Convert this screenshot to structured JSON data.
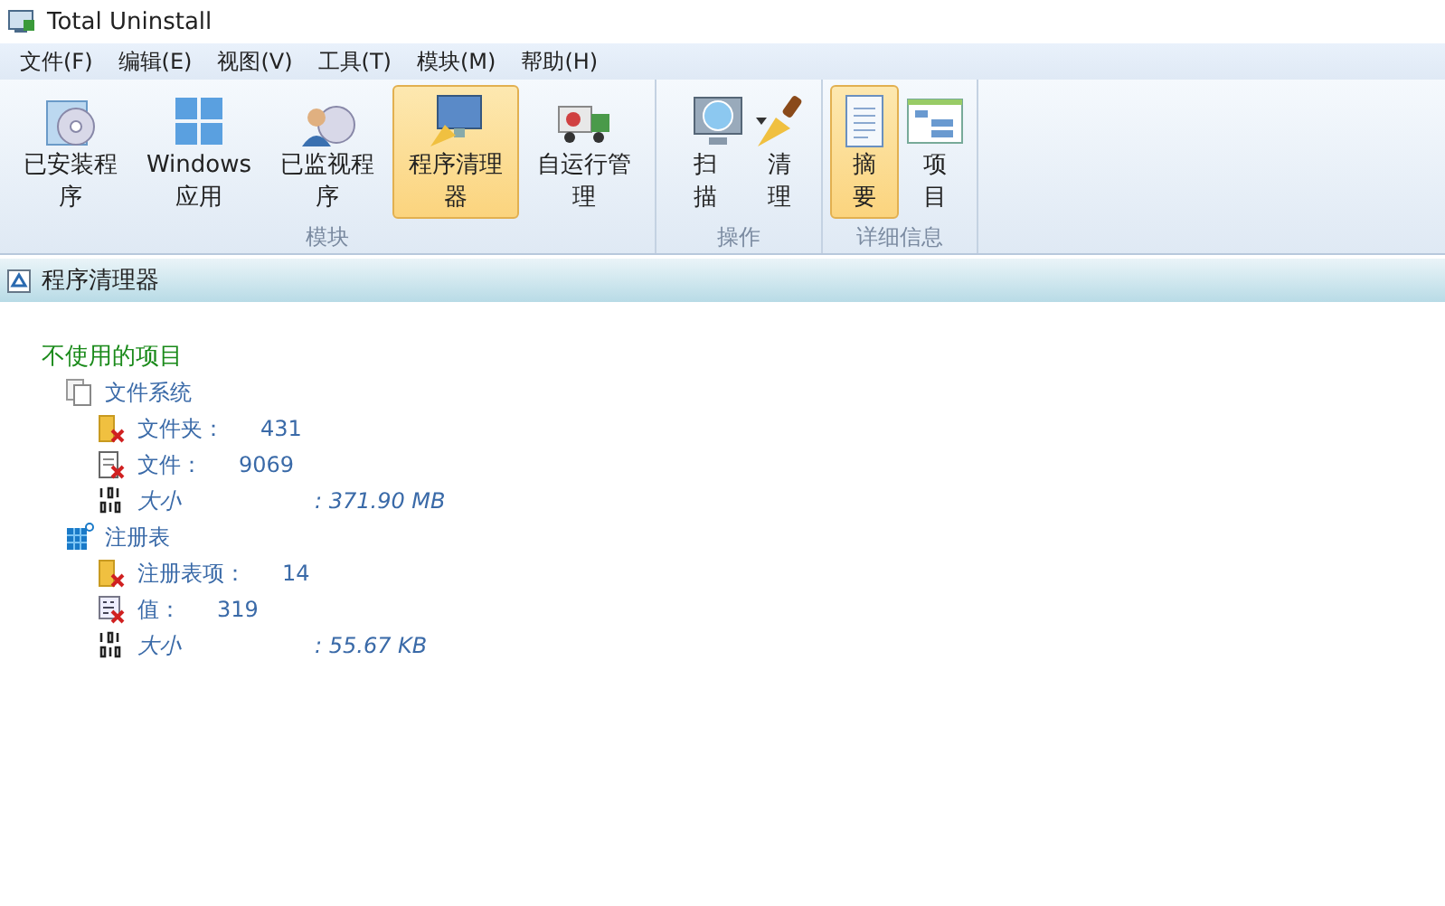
{
  "window": {
    "title": "Total Uninstall"
  },
  "menu": [
    "文件(F)",
    "编辑(E)",
    "视图(V)",
    "工具(T)",
    "模块(M)",
    "帮助(H)"
  ],
  "ribbon": [
    {
      "label": "模块",
      "buttons": [
        {
          "kind": "installed",
          "label": "已安装程序",
          "selected": false
        },
        {
          "kind": "windows",
          "label": "Windows 应用",
          "selected": false
        },
        {
          "kind": "monitored",
          "label": "已监视程序",
          "selected": false
        },
        {
          "kind": "cleaner",
          "label": "程序清理器",
          "selected": true
        },
        {
          "kind": "autorun",
          "label": "自运行管理",
          "selected": false
        }
      ]
    },
    {
      "label": "操作",
      "buttons": [
        {
          "kind": "scan",
          "label": "扫描",
          "selected": false,
          "dropdown": true
        },
        {
          "kind": "clean",
          "label": "清理",
          "selected": false
        }
      ]
    },
    {
      "label": "详细信息",
      "buttons": [
        {
          "kind": "summary",
          "label": "摘要",
          "selected": true
        },
        {
          "kind": "items",
          "label": "项目",
          "selected": false
        }
      ]
    }
  ],
  "panel": {
    "title": "程序清理器"
  },
  "tree": {
    "label": "不使用的项目",
    "children": [
      {
        "kind": "filesystem",
        "label": "文件系统",
        "children": [
          {
            "kind": "folder",
            "label": "文件夹：",
            "value": "431"
          },
          {
            "kind": "file",
            "label": "文件：",
            "value": "9069"
          },
          {
            "kind": "size",
            "label": "大小",
            "value": ": 371.90 MB"
          }
        ]
      },
      {
        "kind": "registry",
        "label": "注册表",
        "children": [
          {
            "kind": "folder",
            "label": "注册表项：",
            "value": "14"
          },
          {
            "kind": "regvalue",
            "label": "值：",
            "value": "319"
          },
          {
            "kind": "size",
            "label": "大小",
            "value": ": 55.67 KB"
          }
        ]
      }
    ]
  }
}
